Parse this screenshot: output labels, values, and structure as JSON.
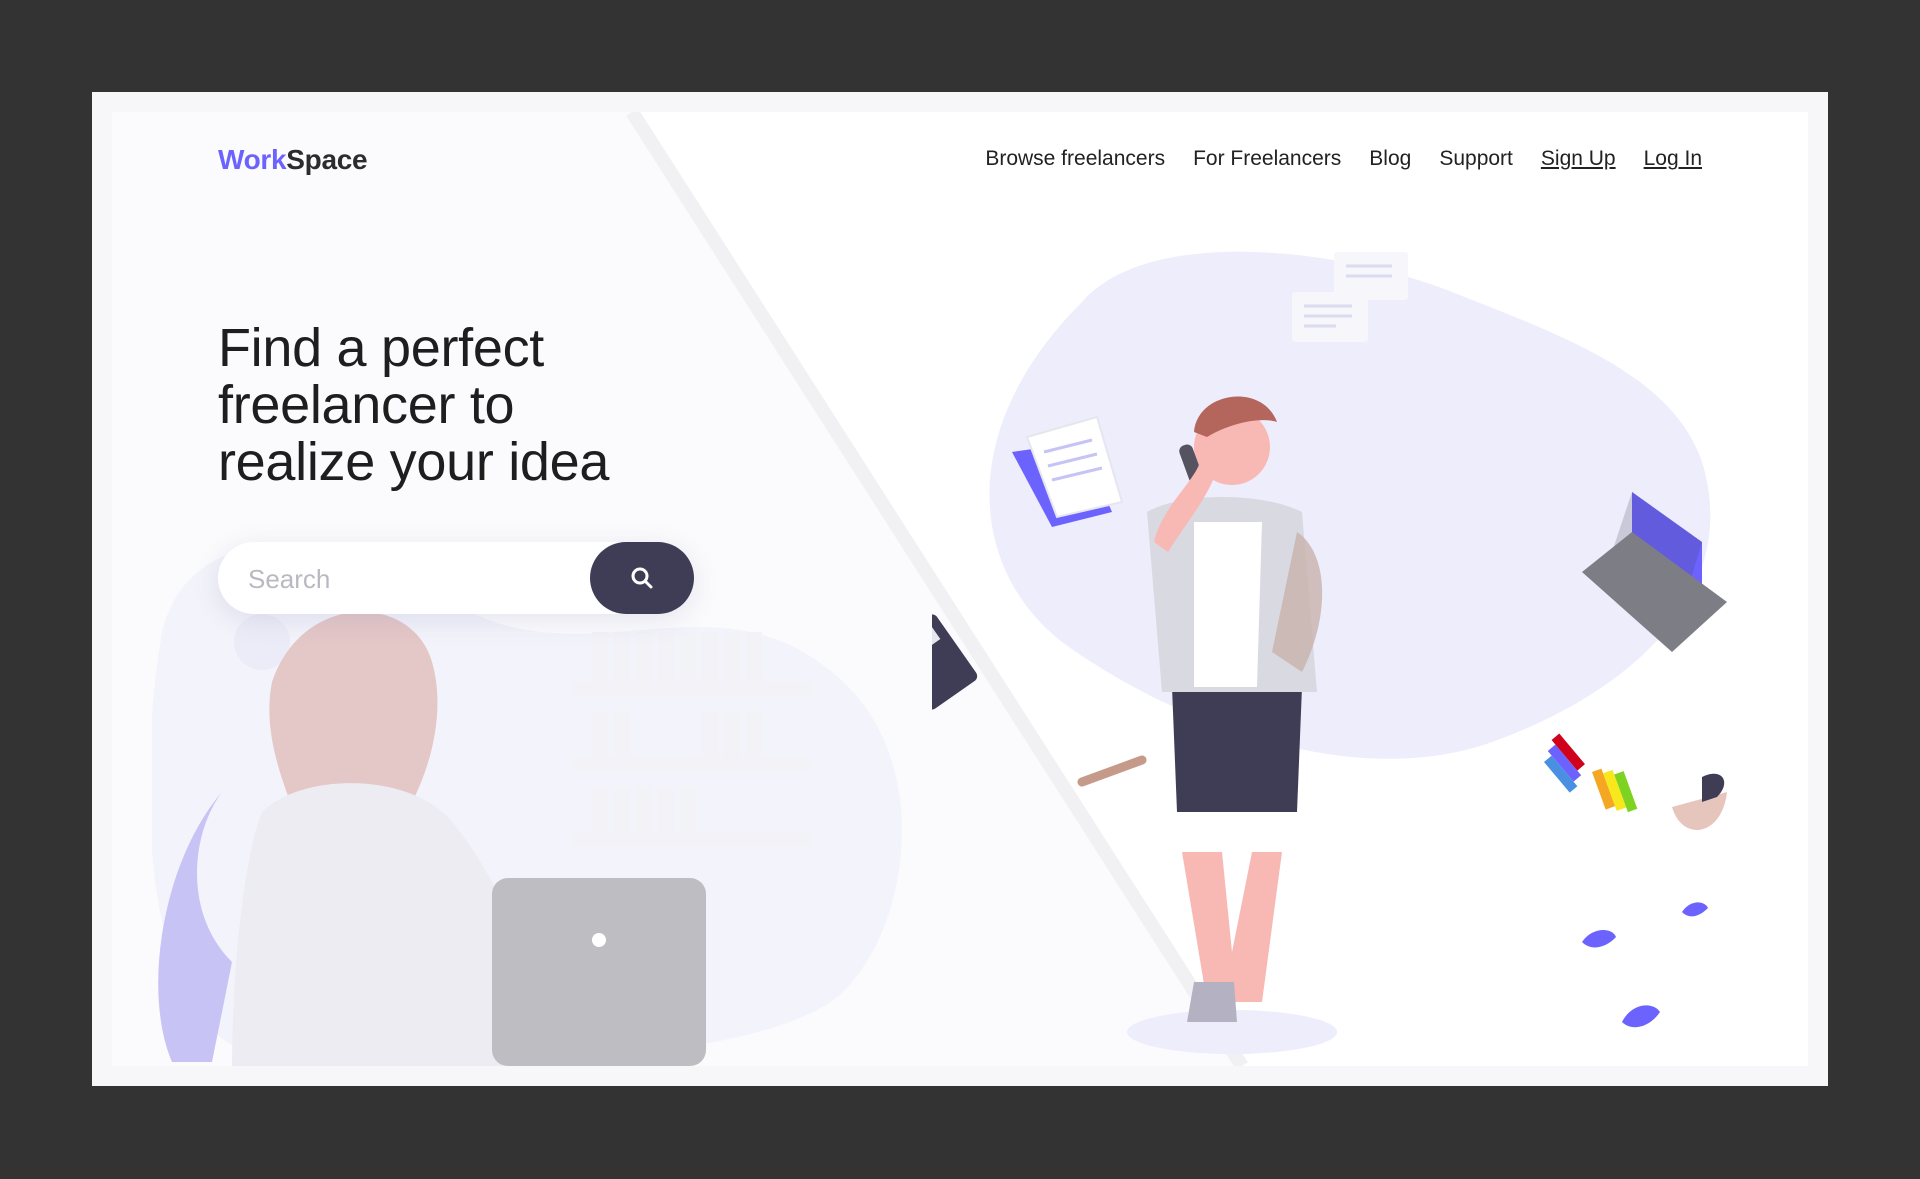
{
  "app": {
    "brand_part1": "Work",
    "brand_part2": "Space",
    "accent_color": "#6c63ff",
    "dark_color": "#3f3d56"
  },
  "nav": {
    "items": [
      {
        "label": "Browse freelancers"
      },
      {
        "label": "For Freelancers"
      },
      {
        "label": "Blog"
      },
      {
        "label": "Support"
      },
      {
        "label": "Sign Up"
      },
      {
        "label": "Log In"
      }
    ]
  },
  "hero": {
    "title_line1": "Find a perfect",
    "title_line2": "freelancer to",
    "title_line3": "realize your idea"
  },
  "search": {
    "placeholder": "Search",
    "value": "",
    "button_icon": "search-icon"
  }
}
